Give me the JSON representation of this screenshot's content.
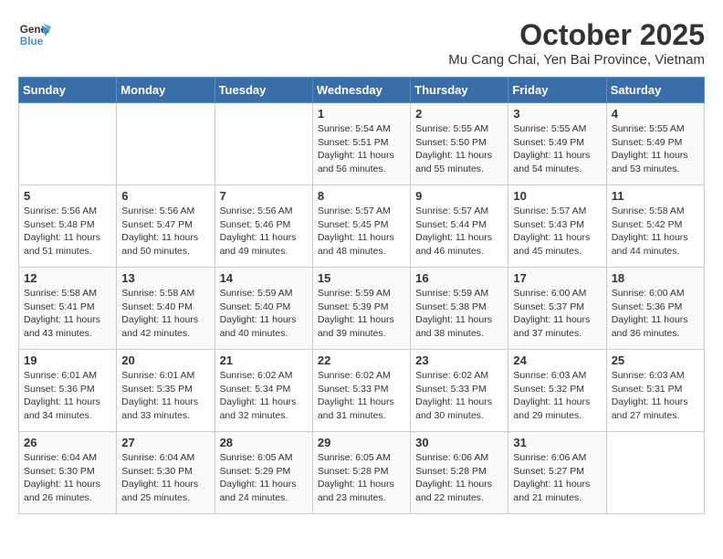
{
  "header": {
    "logo_line1": "General",
    "logo_line2": "Blue",
    "month": "October 2025",
    "location": "Mu Cang Chai, Yen Bai Province, Vietnam"
  },
  "days_of_week": [
    "Sunday",
    "Monday",
    "Tuesday",
    "Wednesday",
    "Thursday",
    "Friday",
    "Saturday"
  ],
  "weeks": [
    [
      {
        "day": "",
        "detail": ""
      },
      {
        "day": "",
        "detail": ""
      },
      {
        "day": "",
        "detail": ""
      },
      {
        "day": "1",
        "detail": "Sunrise: 5:54 AM\nSunset: 5:51 PM\nDaylight: 11 hours\nand 56 minutes."
      },
      {
        "day": "2",
        "detail": "Sunrise: 5:55 AM\nSunset: 5:50 PM\nDaylight: 11 hours\nand 55 minutes."
      },
      {
        "day": "3",
        "detail": "Sunrise: 5:55 AM\nSunset: 5:49 PM\nDaylight: 11 hours\nand 54 minutes."
      },
      {
        "day": "4",
        "detail": "Sunrise: 5:55 AM\nSunset: 5:49 PM\nDaylight: 11 hours\nand 53 minutes."
      }
    ],
    [
      {
        "day": "5",
        "detail": "Sunrise: 5:56 AM\nSunset: 5:48 PM\nDaylight: 11 hours\nand 51 minutes."
      },
      {
        "day": "6",
        "detail": "Sunrise: 5:56 AM\nSunset: 5:47 PM\nDaylight: 11 hours\nand 50 minutes."
      },
      {
        "day": "7",
        "detail": "Sunrise: 5:56 AM\nSunset: 5:46 PM\nDaylight: 11 hours\nand 49 minutes."
      },
      {
        "day": "8",
        "detail": "Sunrise: 5:57 AM\nSunset: 5:45 PM\nDaylight: 11 hours\nand 48 minutes."
      },
      {
        "day": "9",
        "detail": "Sunrise: 5:57 AM\nSunset: 5:44 PM\nDaylight: 11 hours\nand 46 minutes."
      },
      {
        "day": "10",
        "detail": "Sunrise: 5:57 AM\nSunset: 5:43 PM\nDaylight: 11 hours\nand 45 minutes."
      },
      {
        "day": "11",
        "detail": "Sunrise: 5:58 AM\nSunset: 5:42 PM\nDaylight: 11 hours\nand 44 minutes."
      }
    ],
    [
      {
        "day": "12",
        "detail": "Sunrise: 5:58 AM\nSunset: 5:41 PM\nDaylight: 11 hours\nand 43 minutes."
      },
      {
        "day": "13",
        "detail": "Sunrise: 5:58 AM\nSunset: 5:40 PM\nDaylight: 11 hours\nand 42 minutes."
      },
      {
        "day": "14",
        "detail": "Sunrise: 5:59 AM\nSunset: 5:40 PM\nDaylight: 11 hours\nand 40 minutes."
      },
      {
        "day": "15",
        "detail": "Sunrise: 5:59 AM\nSunset: 5:39 PM\nDaylight: 11 hours\nand 39 minutes."
      },
      {
        "day": "16",
        "detail": "Sunrise: 5:59 AM\nSunset: 5:38 PM\nDaylight: 11 hours\nand 38 minutes."
      },
      {
        "day": "17",
        "detail": "Sunrise: 6:00 AM\nSunset: 5:37 PM\nDaylight: 11 hours\nand 37 minutes."
      },
      {
        "day": "18",
        "detail": "Sunrise: 6:00 AM\nSunset: 5:36 PM\nDaylight: 11 hours\nand 36 minutes."
      }
    ],
    [
      {
        "day": "19",
        "detail": "Sunrise: 6:01 AM\nSunset: 5:36 PM\nDaylight: 11 hours\nand 34 minutes."
      },
      {
        "day": "20",
        "detail": "Sunrise: 6:01 AM\nSunset: 5:35 PM\nDaylight: 11 hours\nand 33 minutes."
      },
      {
        "day": "21",
        "detail": "Sunrise: 6:02 AM\nSunset: 5:34 PM\nDaylight: 11 hours\nand 32 minutes."
      },
      {
        "day": "22",
        "detail": "Sunrise: 6:02 AM\nSunset: 5:33 PM\nDaylight: 11 hours\nand 31 minutes."
      },
      {
        "day": "23",
        "detail": "Sunrise: 6:02 AM\nSunset: 5:33 PM\nDaylight: 11 hours\nand 30 minutes."
      },
      {
        "day": "24",
        "detail": "Sunrise: 6:03 AM\nSunset: 5:32 PM\nDaylight: 11 hours\nand 29 minutes."
      },
      {
        "day": "25",
        "detail": "Sunrise: 6:03 AM\nSunset: 5:31 PM\nDaylight: 11 hours\nand 27 minutes."
      }
    ],
    [
      {
        "day": "26",
        "detail": "Sunrise: 6:04 AM\nSunset: 5:30 PM\nDaylight: 11 hours\nand 26 minutes."
      },
      {
        "day": "27",
        "detail": "Sunrise: 6:04 AM\nSunset: 5:30 PM\nDaylight: 11 hours\nand 25 minutes."
      },
      {
        "day": "28",
        "detail": "Sunrise: 6:05 AM\nSunset: 5:29 PM\nDaylight: 11 hours\nand 24 minutes."
      },
      {
        "day": "29",
        "detail": "Sunrise: 6:05 AM\nSunset: 5:28 PM\nDaylight: 11 hours\nand 23 minutes."
      },
      {
        "day": "30",
        "detail": "Sunrise: 6:06 AM\nSunset: 5:28 PM\nDaylight: 11 hours\nand 22 minutes."
      },
      {
        "day": "31",
        "detail": "Sunrise: 6:06 AM\nSunset: 5:27 PM\nDaylight: 11 hours\nand 21 minutes."
      },
      {
        "day": "",
        "detail": ""
      }
    ]
  ]
}
